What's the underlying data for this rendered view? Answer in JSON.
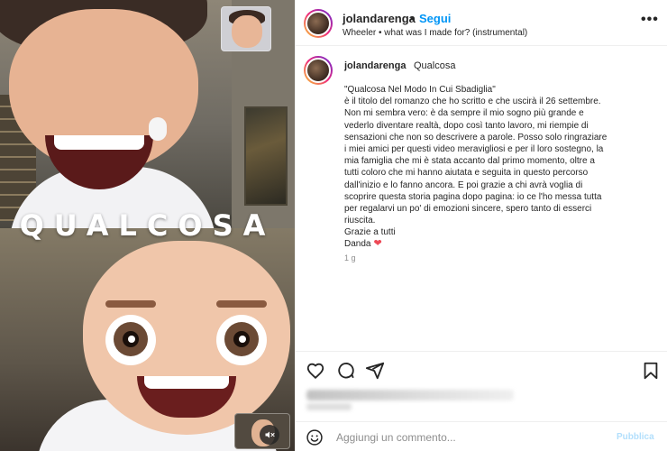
{
  "post": {
    "username": "jolandarenga",
    "follow_label": "Segui",
    "separator": "•",
    "audio": "Wheeler • what was I made for? (instrumental)",
    "more_label": "•••"
  },
  "media": {
    "overlay_text": "QUALCOSA"
  },
  "caption": {
    "username": "jolandarenga",
    "headline": "Qualcosa",
    "lines": [
      "\"Qualcosa Nel Modo In Cui Sbadiglia\"",
      "è il titolo del romanzo che ho scritto e che uscirà il 26 settembre.",
      "Non mi sembra vero: è da sempre il mio sogno più grande e",
      "vederlo diventare realtà, dopo così tanto lavoro, mi riempie di",
      "sensazioni che non so descrivere a parole. Posso solo ringraziare",
      "i miei amici per questi video meravigliosi e per il loro sostegno, la",
      "mia famiglia che mi è stata accanto dal primo momento, oltre a",
      "tutti coloro che mi hanno aiutata e seguita in questo percorso",
      "dall'inizio e lo fanno ancora. E poi grazie a chi avrà voglia di",
      "scoprire questa storia pagina dopo pagina: io ce l'ho messa tutta",
      "per regalarvi un po' di emozioni sincere, spero tanto di esserci",
      "riuscita.",
      "Grazie a tutti"
    ],
    "signature": "Danda",
    "heart": "❤",
    "time": "1 g"
  },
  "comment_box": {
    "placeholder": "Aggiungi un commento...",
    "publish_label": "Pubblica"
  },
  "icons": {
    "like": "heart-outline-icon",
    "comment": "comment-icon",
    "share": "paper-plane-icon",
    "save": "bookmark-icon",
    "emoji": "smiley-icon",
    "mute": "speaker-muted-icon",
    "more": "more-options-icon"
  },
  "colors": {
    "follow_blue": "#0095f6",
    "heart_red": "#ed4956",
    "publish_disabled": "#b2dffc"
  }
}
